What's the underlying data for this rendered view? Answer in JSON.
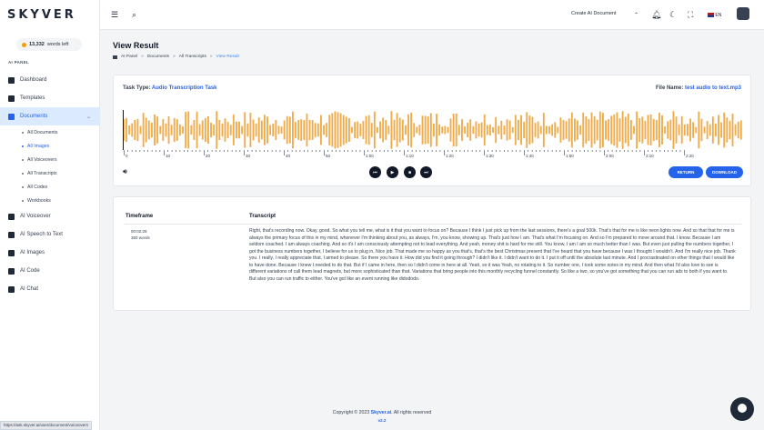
{
  "brand": {
    "logo": "SKYVER"
  },
  "sidebar": {
    "words_left": "13,332",
    "words_left_suffix": "words left",
    "section_label": "AI PANEL",
    "items": [
      {
        "label": "Dashboard",
        "icon": "dashboard-icon"
      },
      {
        "label": "Templates",
        "icon": "templates-icon"
      },
      {
        "label": "Documents",
        "icon": "documents-icon"
      },
      {
        "label": "AI Voiceover",
        "icon": "voiceover-icon"
      },
      {
        "label": "AI Speech to Text",
        "icon": "speech-icon"
      },
      {
        "label": "AI Images",
        "icon": "images-icon"
      },
      {
        "label": "AI Code",
        "icon": "code-icon"
      },
      {
        "label": "AI Chat",
        "icon": "chat-icon"
      }
    ],
    "documents_sub": [
      "All Documents",
      "All Images",
      "All Voiceovers",
      "All Transcripts",
      "All Codes",
      "Workbooks"
    ]
  },
  "topbar": {
    "create_label": "Create AI Document",
    "lang": "EN"
  },
  "page": {
    "title": "View Result",
    "breadcrumb": [
      "AI Panel",
      "Documents",
      "All Transcripts",
      "View Result"
    ]
  },
  "task": {
    "type_label": "Task Type:",
    "type_value": "Audio Transcription Task",
    "file_label": "File Name:",
    "file_value": "test audio to text.mp3"
  },
  "timeline": [
    "0",
    "10",
    "20",
    "30",
    "40",
    "50",
    "1:00",
    "1:10",
    "1:20",
    "1:30",
    "1:40",
    "1:50",
    "2:00",
    "2:10",
    "2:20"
  ],
  "player": {
    "return_label": "RETURN",
    "download_label": "DOWNLOAD"
  },
  "table": {
    "col_timeframe": "Timeframe",
    "col_transcript": "Transcript",
    "time": "00:02:28",
    "words": "350 words",
    "text": "Right, that's recording now. Okay, good. So what you tell me, what is it that you want to focus on? Because I think I just pick up from the last sessions, there's a goal 500k. That's that for me is like neon lights now. And so that that for me is always the primary focus of this in my mind, whenever I'm thinking about you, as always, I'm, you know, showing up. That's just how I am. That's what I'm focusing on. And so I'm prepared to move around that. I know. Because I am seldom coached. I am always coaching. And so it's I am consciously attempting not to lead everything. And yeah, money shit is hard for me still. You know, I am I am so much better than I was. But even just pulling the numbers together, I got the business numbers together, I believe for us to plug in, Nice job. That made me so happy as you that's, that's the best Christmas present that I've heard that you have because I was I thought I wouldn't. And I'm really nice job. Thank you. I really, I really appreciate that. I aimed to please. So there you have it. How did you find it going through? I didn't like it. I didn't want to do it. I put it off until the absolute last minute. And I procrastinated on other things that I would like to have done. Because I knew I needed to do that. But if I came in here, then so I didn't come in here at all. Yeah, so it was Yeah, no rotating to it. So number one, I took some notes in my mind. And then what I'd also love to see is different variations of call them lead magnets, but more sophisticated than that. Variations that bring people into this monthly recycling funnel constantly. So like a two, so you've got something that you can run ads to both if you want to. But also you can run traffic to either. You've got like an event running like didododo."
  },
  "footer": {
    "prefix": "Copyright © 2023",
    "brand": "Skyver.ai",
    "suffix": ". All rights reserved",
    "version": "v2.2"
  },
  "status_url": "https://ask.skyver.ai/user/document/voiceovers",
  "colors": {
    "accent": "#2563eb",
    "wave": "#f0ab4b",
    "dark": "#111827"
  }
}
